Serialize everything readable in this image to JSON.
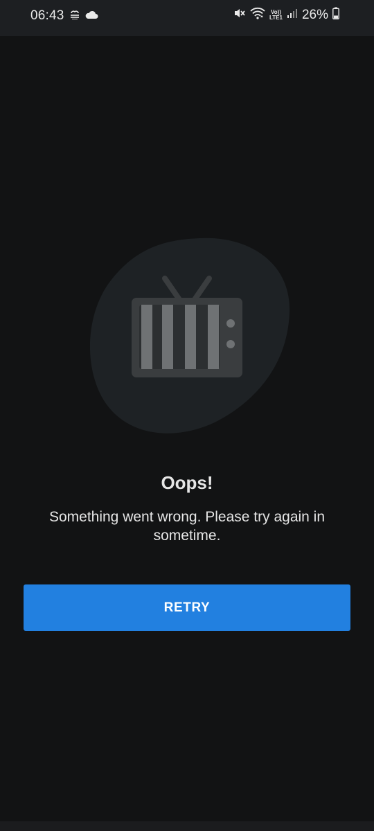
{
  "status_bar": {
    "time": "06:43",
    "battery_percent": "26%",
    "network_label_top": "Vo))",
    "network_label_bottom": "LTE1",
    "left_icons": [
      "fog-icon",
      "cloud-icon"
    ],
    "right_icons": [
      "mute-icon",
      "wifi-icon",
      "volte-lte-icon",
      "signal-icon",
      "battery-icon"
    ],
    "battery_level": 0.26
  },
  "illustration": {
    "icon": "broken-tv-icon",
    "blob_color": "#1e2225",
    "tv_color": "#3a3d3f",
    "stripe_color": "#6f7274"
  },
  "error": {
    "title": "Oops!",
    "message": "Something went wrong. Please try again in sometime."
  },
  "actions": {
    "retry_label": "RETRY"
  },
  "colors": {
    "background": "#121314",
    "accent": "#2280e0",
    "text": "#e6e6e6"
  }
}
